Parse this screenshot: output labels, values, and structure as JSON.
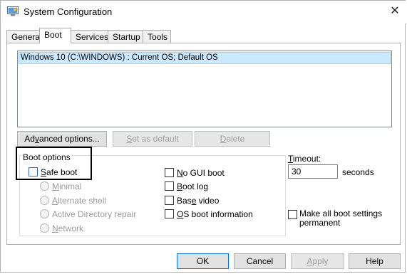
{
  "window": {
    "title": "System Configuration",
    "close": "✕"
  },
  "tabs": [
    "General",
    "Boot",
    "Services",
    "Startup",
    "Tools"
  ],
  "active_tab": "Boot",
  "os_list": {
    "items": [
      "Windows 10 (C:\\WINDOWS) : Current OS; Default OS"
    ],
    "selected_index": 0
  },
  "buttons": {
    "advanced_pre": "Ad",
    "advanced_u": "v",
    "advanced_post": "anced options...",
    "set_default_pre": "",
    "set_default_u": "S",
    "set_default_post": "et as default",
    "delete_pre": "",
    "delete_u": "D",
    "delete_post": "elete"
  },
  "boot_options": {
    "label": "Boot options",
    "safe_boot": {
      "pre": "",
      "u": "S",
      "post": "afe boot",
      "checked": false
    },
    "radios": [
      {
        "pre": "",
        "u": "M",
        "post": "inimal"
      },
      {
        "pre": "",
        "u": "A",
        "post": "lternate shell"
      },
      {
        "pre": "Active Directory repair",
        "u": "",
        "post": ""
      },
      {
        "pre": "",
        "u": "N",
        "post": "etwork"
      }
    ],
    "right_checks": [
      {
        "pre": "",
        "u": "N",
        "post": "o GUI boot",
        "checked": false
      },
      {
        "pre": "",
        "u": "B",
        "post": "oot log",
        "checked": false
      },
      {
        "pre": "Bas",
        "u": "e",
        "post": " video",
        "checked": false
      },
      {
        "pre": "",
        "u": "O",
        "post": "S boot information",
        "checked": false
      }
    ]
  },
  "timeout": {
    "label_pre": "",
    "label_u": "T",
    "label_post": "imeout:",
    "value": "30",
    "unit": "seconds"
  },
  "make_permanent": {
    "line1": "Make all boot settings",
    "line2": "permanent",
    "checked": false
  },
  "footer": {
    "ok": "OK",
    "cancel": "Cancel",
    "apply_pre": "",
    "apply_u": "A",
    "apply_post": "pply",
    "help": "Help"
  }
}
